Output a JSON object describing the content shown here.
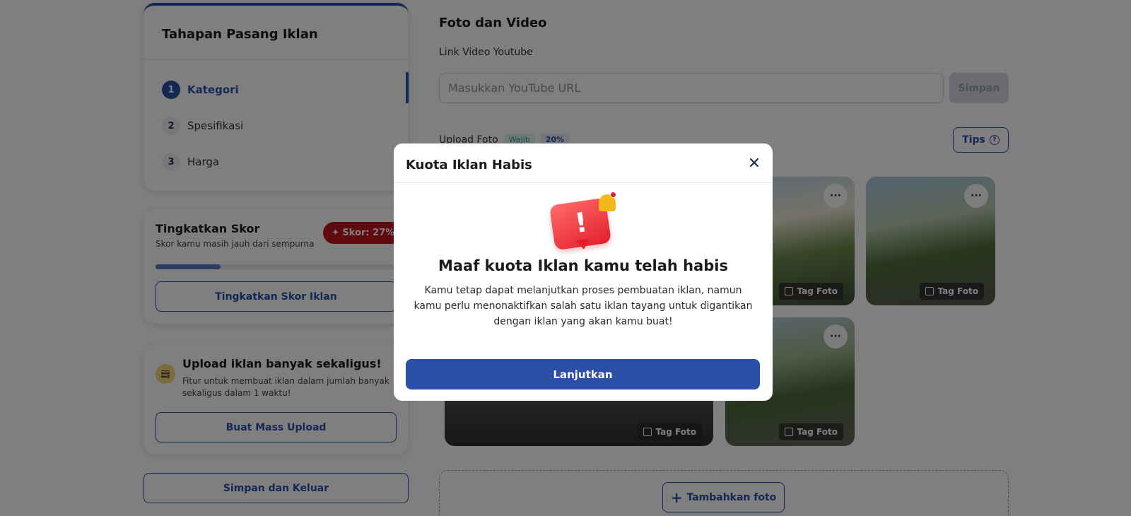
{
  "steps": {
    "title": "Tahapan Pasang Iklan",
    "items": [
      {
        "num": "1",
        "label": "Kategori"
      },
      {
        "num": "2",
        "label": "Spesifikasi"
      },
      {
        "num": "3",
        "label": "Harga"
      }
    ]
  },
  "score": {
    "title": "Tingkatkan Skor",
    "subtitle": "Skor kamu masih jauh dari sempurna",
    "badge": "✦ Skor: 27%",
    "progress_percent": 27,
    "button": "Tingkatkan Skor Iklan"
  },
  "mass_upload": {
    "title": "Upload iklan banyak sekaligus!",
    "description": "Fitur untuk membuat iklan dalam jumlah banyak sekaligus dalam 1 waktu!",
    "button": "Buat Mass Upload"
  },
  "save_exit": "Simpan dan Keluar",
  "media": {
    "section_title": "Foto dan Video",
    "youtube_label": "Link Video Youtube",
    "youtube_placeholder": "Masukkan YouTube URL",
    "save_button": "Simpan",
    "upload_label": "Upload Foto",
    "tag_required": "Wajib",
    "tag_percent": "20%",
    "tips_button": "Tips",
    "photo_more": "···",
    "photo_tag": "Tag Foto",
    "add_photo": "Tambahkan foto"
  },
  "modal": {
    "title": "Kuota Iklan Habis",
    "close": "✕",
    "heading": "Maaf kuota Iklan kamu telah habis",
    "body": "Kamu tetap dapat melanjutkan proses pembuatan iklan, namun kamu perlu menonaktifkan salah satu iklan tayang untuk digantikan dengan iklan yang akan kamu buat!",
    "button": "Lanjutkan"
  },
  "colors": {
    "primary": "#2b4fa6",
    "danger": "#c1121f",
    "overlay": "rgba(0,0,0,0.5)"
  }
}
